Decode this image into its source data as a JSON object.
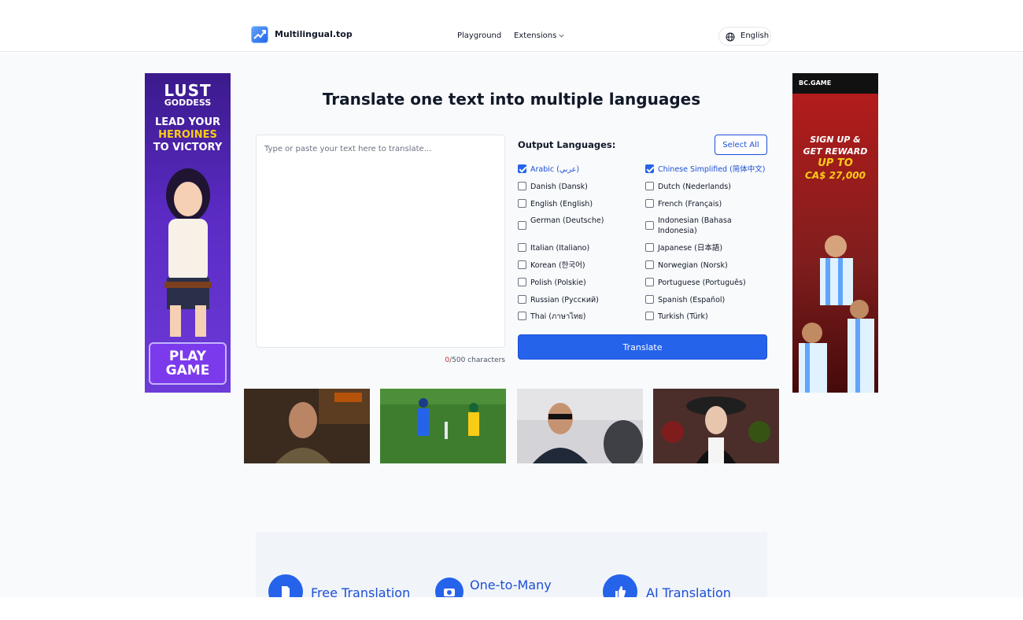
{
  "header": {
    "brand": "Multilingual.top",
    "nav": {
      "playground": "Playground",
      "extensions": "Extensions"
    },
    "language": "English"
  },
  "ads": {
    "left": {
      "line1": "LUST",
      "line2": "GODDESS",
      "line3": "LEAD YOUR",
      "line4": "HEROINES",
      "line5": "TO VICTORY",
      "cta1": "PLAY",
      "cta2": "GAME"
    },
    "right": {
      "brand": "BC.GAME",
      "line1": "SIGN UP &",
      "line2": "GET REWARD",
      "line3": "UP TO",
      "line4": "CA$ 27,000"
    }
  },
  "main": {
    "title": "Translate one text into multiple languages",
    "input": {
      "placeholder": "Type or paste your text here to translate...",
      "value": ""
    },
    "char_count": "0",
    "char_limit": "/500 characters",
    "output_label": "Output Languages:",
    "select_all": "Select All",
    "translate": "Translate",
    "languages": [
      {
        "label": "Arabic (عربي)",
        "checked": true
      },
      {
        "label": "Chinese Simplified (简体中文)",
        "checked": true
      },
      {
        "label": "Danish (Dansk)",
        "checked": false
      },
      {
        "label": "Dutch (Nederlands)",
        "checked": false
      },
      {
        "label": "English (English)",
        "checked": false
      },
      {
        "label": "French (Français)",
        "checked": false
      },
      {
        "label": "German (Deutsche)",
        "checked": false
      },
      {
        "label": "Indonesian (Bahasa Indonesia)",
        "checked": false
      },
      {
        "label": "Italian (Italiano)",
        "checked": false
      },
      {
        "label": "Japanese (日本語)",
        "checked": false
      },
      {
        "label": "Korean (한국어)",
        "checked": false
      },
      {
        "label": "Norwegian (Norsk)",
        "checked": false
      },
      {
        "label": "Polish (Polskie)",
        "checked": false
      },
      {
        "label": "Portuguese (Português)",
        "checked": false
      },
      {
        "label": "Russian (Русский)",
        "checked": false
      },
      {
        "label": "Spanish (Español)",
        "checked": false
      },
      {
        "label": "Thai (ภาษาไทย)",
        "checked": false
      },
      {
        "label": "Turkish (Türk)",
        "checked": false
      }
    ]
  },
  "features": [
    {
      "label": "Free Translation",
      "icon": "document-icon"
    },
    {
      "label": "One-to-Many",
      "icon": "camera-icon"
    },
    {
      "label": "AI Translation",
      "icon": "thumbs-up-icon"
    }
  ],
  "colors": {
    "primary": "#2563eb",
    "primary_dark": "#1d4ed8",
    "count_red": "#dc2626"
  }
}
